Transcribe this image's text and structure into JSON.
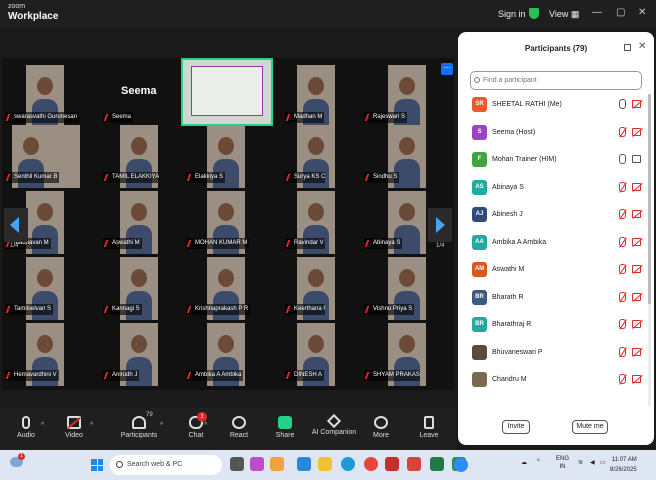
{
  "window": {
    "brand_small": "zoom",
    "brand_title": "Workplace",
    "sign_in": "Sign in",
    "view": "View"
  },
  "gallery": {
    "page_left": "1/4",
    "page_right": "1/4",
    "speaker_label": "Seema",
    "tiles": [
      {
        "name": "swarasvathi Gurunesan"
      },
      {
        "name": "Seema"
      },
      {
        "name": "Mohan Trainer (HIM)"
      },
      {
        "name": "Madhan M"
      },
      {
        "name": "Rajeswari S"
      },
      {
        "name": "Senthil Kumar B"
      },
      {
        "name": "TAMIL ELAKKIYA T"
      },
      {
        "name": "Elakkiya S"
      },
      {
        "name": "Surya KS C"
      },
      {
        "name": "Sindhu S"
      },
      {
        "name": "Madhavan M"
      },
      {
        "name": "Aswathi M"
      },
      {
        "name": "MOHAN KUMAR M"
      },
      {
        "name": "Ravindar V"
      },
      {
        "name": "Abinaya S"
      },
      {
        "name": "Tamilselvan S"
      },
      {
        "name": "Kannagi S"
      },
      {
        "name": "Krishnaprakash P R"
      },
      {
        "name": "Keerthana R"
      },
      {
        "name": "Vishnu Priya S"
      },
      {
        "name": "Hemavardhini V"
      },
      {
        "name": "Anirudh J"
      },
      {
        "name": "Ambika A Ambika"
      },
      {
        "name": "DINESH A"
      },
      {
        "name": "SHYAM PRAKASH"
      }
    ]
  },
  "toolbar": {
    "audio": "Audio",
    "video": "Video",
    "participants": "Participants",
    "participants_count": "79",
    "chat": "Chat",
    "chat_badge": "1",
    "react": "React",
    "share": "Share",
    "ai": "AI Companion",
    "more": "More",
    "leave": "Leave"
  },
  "panel": {
    "title": "Participants (79)",
    "search_placeholder": "Find a participant",
    "invite": "Invite",
    "mute_me": "Mute me",
    "participants": [
      {
        "initials": "SR",
        "name": "SHEETAL RATHI (Me)",
        "color": "#e85a2a",
        "mic": "on",
        "cam": "off"
      },
      {
        "initials": "S",
        "name": "Seema (Host)",
        "color": "#9b44c4",
        "mic": "muted",
        "cam": "off"
      },
      {
        "initials": "F",
        "name": "Mohan Trainer (HIM)",
        "color": "#3fa53f",
        "mic": "on",
        "cam": "on"
      },
      {
        "initials": "AS",
        "name": "Abinaya S",
        "color": "#23a9a0",
        "mic": "muted",
        "cam": "off"
      },
      {
        "initials": "AJ",
        "name": "Abinesh J",
        "color": "#2e4b7a",
        "mic": "muted",
        "cam": "off"
      },
      {
        "initials": "AA",
        "name": "Ambika A Ambika",
        "color": "#23a9a0",
        "mic": "muted",
        "cam": "off"
      },
      {
        "initials": "AM",
        "name": "Aswathi M",
        "color": "#d9581d",
        "mic": "muted",
        "cam": "off"
      },
      {
        "initials": "BR",
        "name": "Bharath R",
        "color": "#3c5a80",
        "mic": "muted",
        "cam": "off"
      },
      {
        "initials": "BR",
        "name": "Bharathraj R",
        "color": "#23a9a0",
        "mic": "muted",
        "cam": "off"
      },
      {
        "initials": "",
        "name": "Bhuvaneswari P",
        "color": "#5a4a3a",
        "mic": "muted",
        "cam": "off"
      },
      {
        "initials": "",
        "name": "Chandru M",
        "color": "#7a6a50",
        "mic": "muted",
        "cam": "off"
      }
    ]
  },
  "taskbar": {
    "weather_badge": "1",
    "search_placeholder": "Search web & PC",
    "lang_top": "ENG",
    "lang_bottom": "IN",
    "time": "11:07 AM",
    "date": "8/26/2025"
  }
}
